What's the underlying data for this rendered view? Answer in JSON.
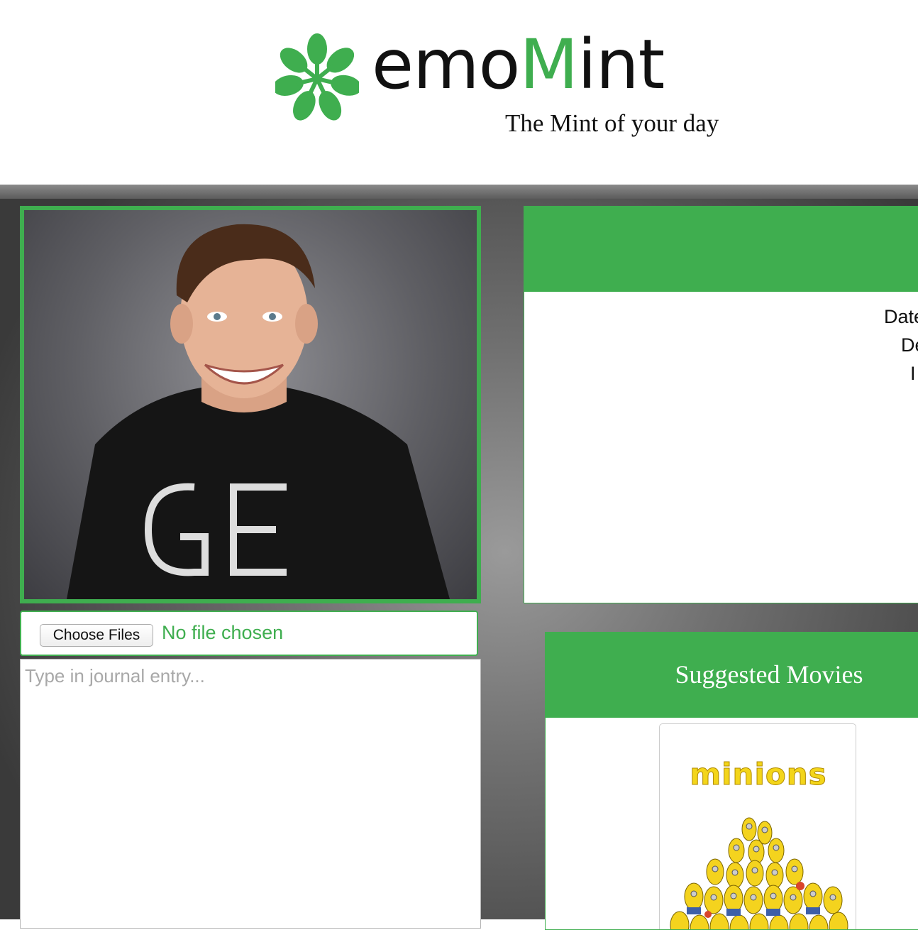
{
  "brand": {
    "name_prefix": "emo",
    "name_accent": "M",
    "name_suffix": "int",
    "tagline": "The Mint of your day",
    "accent_color": "#3fae4f",
    "logo_icon": "mint-flower-icon"
  },
  "upload": {
    "button_label": "Choose Files",
    "status": "No file chosen"
  },
  "journal": {
    "placeholder": "Type in journal entry..."
  },
  "info_panel": {
    "lines": [
      "Date",
      "De",
      "I"
    ]
  },
  "movies": {
    "title": "Suggested Movies",
    "items": [
      {
        "poster_title": "minions"
      }
    ]
  }
}
